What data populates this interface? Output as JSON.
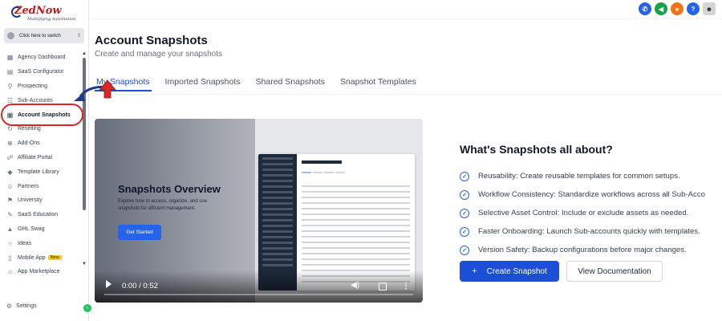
{
  "sidebar": {
    "logo": {
      "main": "ZedNow",
      "tagline": "Multiplying Automation"
    },
    "switcher_label": "Click here to switch",
    "items": [
      {
        "label": "Agency Dashboard",
        "icon": "dashboard-icon"
      },
      {
        "label": "SaaS Configurator",
        "icon": "chart-icon"
      },
      {
        "label": "Prospecting",
        "icon": "user-search-icon"
      },
      {
        "label": "Sub-Accounts",
        "icon": "users-icon"
      },
      {
        "label": "Account Snapshots",
        "icon": "snapshot-icon"
      },
      {
        "label": "Reselling",
        "icon": "refresh-icon"
      },
      {
        "label": "Add-Ons",
        "icon": "plus-circle-icon"
      },
      {
        "label": "Affiliate Portal",
        "icon": "handshake-icon"
      },
      {
        "label": "Template Library",
        "icon": "template-icon"
      },
      {
        "label": "Partners",
        "icon": "partners-icon"
      },
      {
        "label": "University",
        "icon": "graduation-icon"
      },
      {
        "label": "SaaS Education",
        "icon": "education-icon"
      },
      {
        "label": "GHL Swag",
        "icon": "shirt-icon"
      },
      {
        "label": "Ideas",
        "icon": "bulb-icon"
      },
      {
        "label": "Mobile App",
        "icon": "phone-icon",
        "badge": "New"
      },
      {
        "label": "App Marketplace",
        "icon": "store-icon"
      }
    ],
    "settings_label": "Settings"
  },
  "topbar": {
    "icons": [
      {
        "name": "phone-icon",
        "color": "#2563eb"
      },
      {
        "name": "megaphone-icon",
        "color": "#16a34a"
      },
      {
        "name": "bell-icon",
        "color": "#f97316"
      },
      {
        "name": "help-icon",
        "color": "#2563eb"
      },
      {
        "name": "avatar",
        "color": "#d6d3d1"
      }
    ]
  },
  "page": {
    "title": "Account Snapshots",
    "subtitle": "Create and manage your snapshots"
  },
  "tabs": [
    {
      "label": "My Snapshots",
      "active": true
    },
    {
      "label": "Imported Snapshots",
      "active": false
    },
    {
      "label": "Shared Snapshots",
      "active": false
    },
    {
      "label": "Snapshot Templates",
      "active": false
    }
  ],
  "video": {
    "title": "Snapshots Overview",
    "description": "Explore how to access, organize, and use snapshots for efficient management.",
    "cta_label": "Get Started",
    "time": "0:00 / 0:52",
    "progress": 0.0
  },
  "about": {
    "title": "What's Snapshots all about?",
    "features": [
      "Reusability: Create reusable templates for common setups.",
      "Workflow Consistency: Standardize workflows across all Sub-Acco",
      "Selective Asset Control: Include or exclude assets as needed.",
      "Faster Onboarding: Launch Sub-accounts quickly with templates.",
      "Version Safety: Backup configurations before major changes."
    ]
  },
  "actions": {
    "create_label": "Create Snapshot",
    "docs_label": "View Documentation"
  },
  "colors": {
    "accent": "#1d4ed8",
    "highlight": "#dc2626"
  }
}
